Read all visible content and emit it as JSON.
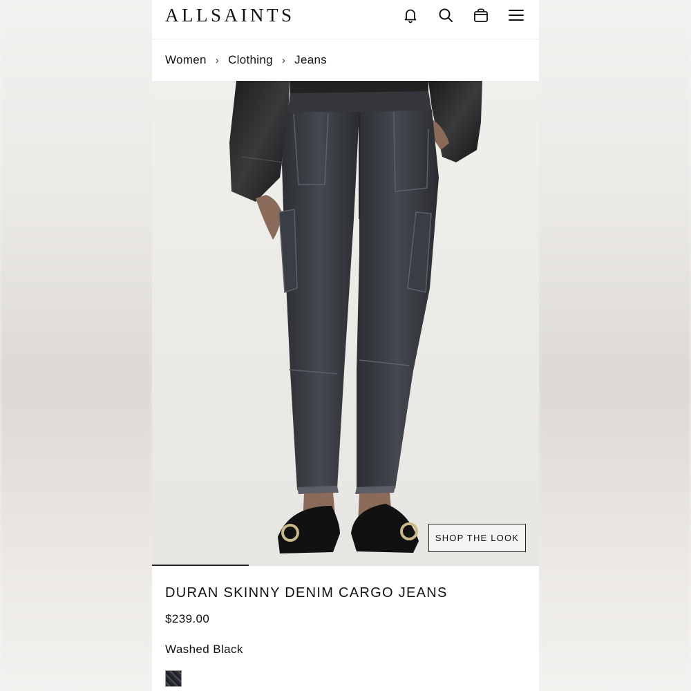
{
  "header": {
    "logo": "ALLSAINTS",
    "icons": [
      "bell-icon",
      "search-icon",
      "bag-icon",
      "menu-icon"
    ]
  },
  "breadcrumb": {
    "items": [
      "Women",
      "Clothing",
      "Jeans"
    ],
    "separator": "›"
  },
  "gallery": {
    "shop_the_look_label": "SHOP THE LOOK",
    "progress_fraction": 0.25
  },
  "product": {
    "title": "DURAN SKINNY DENIM CARGO JEANS",
    "price": "$239.00",
    "color_name": "Washed Black",
    "swatch_color": "#2b2d33"
  },
  "colors": {
    "accent": "#111111",
    "background": "#ffffff"
  }
}
